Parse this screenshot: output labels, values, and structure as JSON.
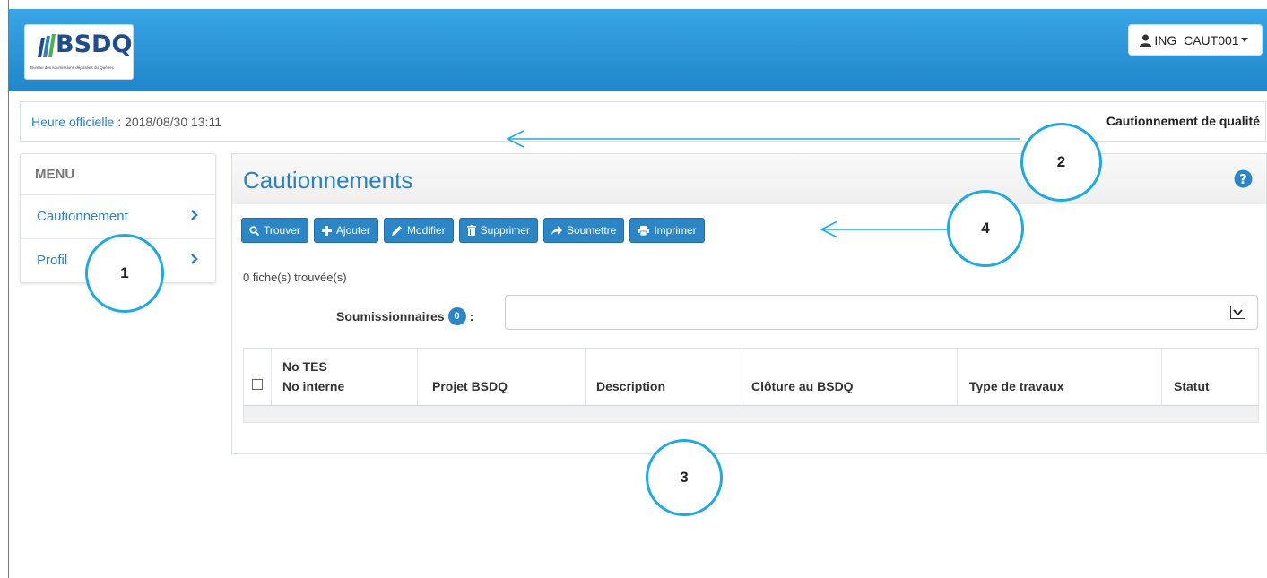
{
  "header": {
    "logo_text": "BSDQ",
    "logo_subtitle": "Bureau des soumissions déposées du Québec",
    "user_label": "ING_CAUT001"
  },
  "infobar": {
    "time_label": "Heure officielle",
    "time_sep": " : ",
    "time_value": "2018/08/30 13:11",
    "right_title": "Cautionnement de qualité"
  },
  "menu": {
    "title": "MENU",
    "items": [
      {
        "label": "Cautionnement"
      },
      {
        "label": "Profil"
      }
    ]
  },
  "panel": {
    "title": "Cautionnements",
    "toolbar": [
      {
        "label": "Trouver",
        "icon": "search-icon"
      },
      {
        "label": "Ajouter",
        "icon": "plus-icon"
      },
      {
        "label": "Modifier",
        "icon": "pencil-icon"
      },
      {
        "label": "Supprimer",
        "icon": "trash-icon"
      },
      {
        "label": "Soumettre",
        "icon": "share-arrow-icon"
      },
      {
        "label": "Imprimer",
        "icon": "print-icon"
      }
    ],
    "found_text": "0 fiche(s) trouvée(s)",
    "soumissionnaires_label": "Soumissionnaires",
    "soumissionnaires_count": "0",
    "soumissionnaires_colon": ":",
    "table_headers": {
      "col1_line1": "No TES",
      "col1_line2": "No interne",
      "col2": "Projet BSDQ",
      "col3": "Description",
      "col4": "Clôture au BSDQ",
      "col5": "Type de travaux",
      "col6": "Statut"
    }
  },
  "callouts": [
    "1",
    "2",
    "3",
    "4"
  ],
  "colors": {
    "header_blue": "#1f86cb",
    "accent_blue": "#2a86c6",
    "callout_blue": "#1aaae8"
  }
}
